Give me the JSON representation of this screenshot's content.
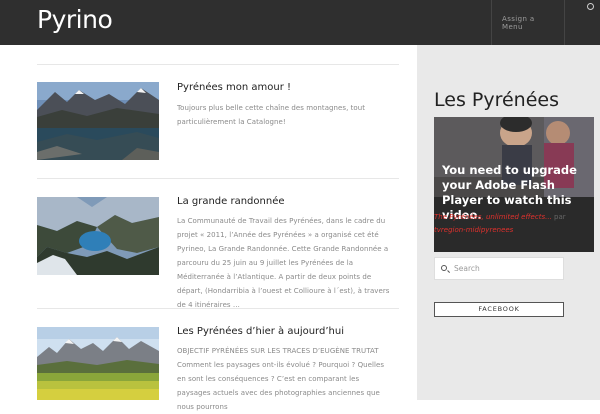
{
  "site": {
    "title": "Pyrino"
  },
  "nav": {
    "menu_label": "Assign a Menu"
  },
  "posts": [
    {
      "title": "Pyrénées mon amour !",
      "excerpt": "Toujours plus belle cette chaîne des montagnes, tout particulièrement la Catalogne!"
    },
    {
      "title": "La grande randonnée",
      "excerpt": "La Communauté de Travail des Pyrénées, dans le cadre du projet « 2011, l’Année des Pyrénées » a organisé cet été Pyrineo, La Grande Randonnée. Cette Grande Randonnée a parcouru du 25 juin au 9 juillet les Pyrénées de la Méditerranée à l’Atlantique. A partir de deux points de départ, (Hondarribia à l’ouest et Collioure à l´est), à travers de 4 itinéraires …"
    },
    {
      "title": "Les Pyrénées d’hier à aujourd’hui",
      "excerpt": "OBJECTIF PYRÉNÉES SUR LES TRACES D’EUGÈNE TRUTAT Comment les paysages ont-ils évolué ? Pourquoi ? Quelles en sont les conséquences ? C’est en comparant les paysages actuels avec des photographies anciennes que nous pourrons"
    }
  ],
  "sidebar": {
    "title": "Les Pyrénées",
    "video_message": "You need to upgrade your Adobe Flash Player to watch this video.",
    "caption_link": "The Pyrénées, unlimited effects...",
    "caption_by": " par ",
    "caption_author": "tvregion-midipyrenees",
    "search_placeholder": "Search",
    "facebook_label": "FACEBOOK"
  },
  "colors": {
    "header": "#2f2f2f",
    "sidebar_bg": "#e9e9e9",
    "accent_red": "#e0312d"
  },
  "icons": {
    "settings": "gear-icon",
    "search": "search-icon"
  }
}
